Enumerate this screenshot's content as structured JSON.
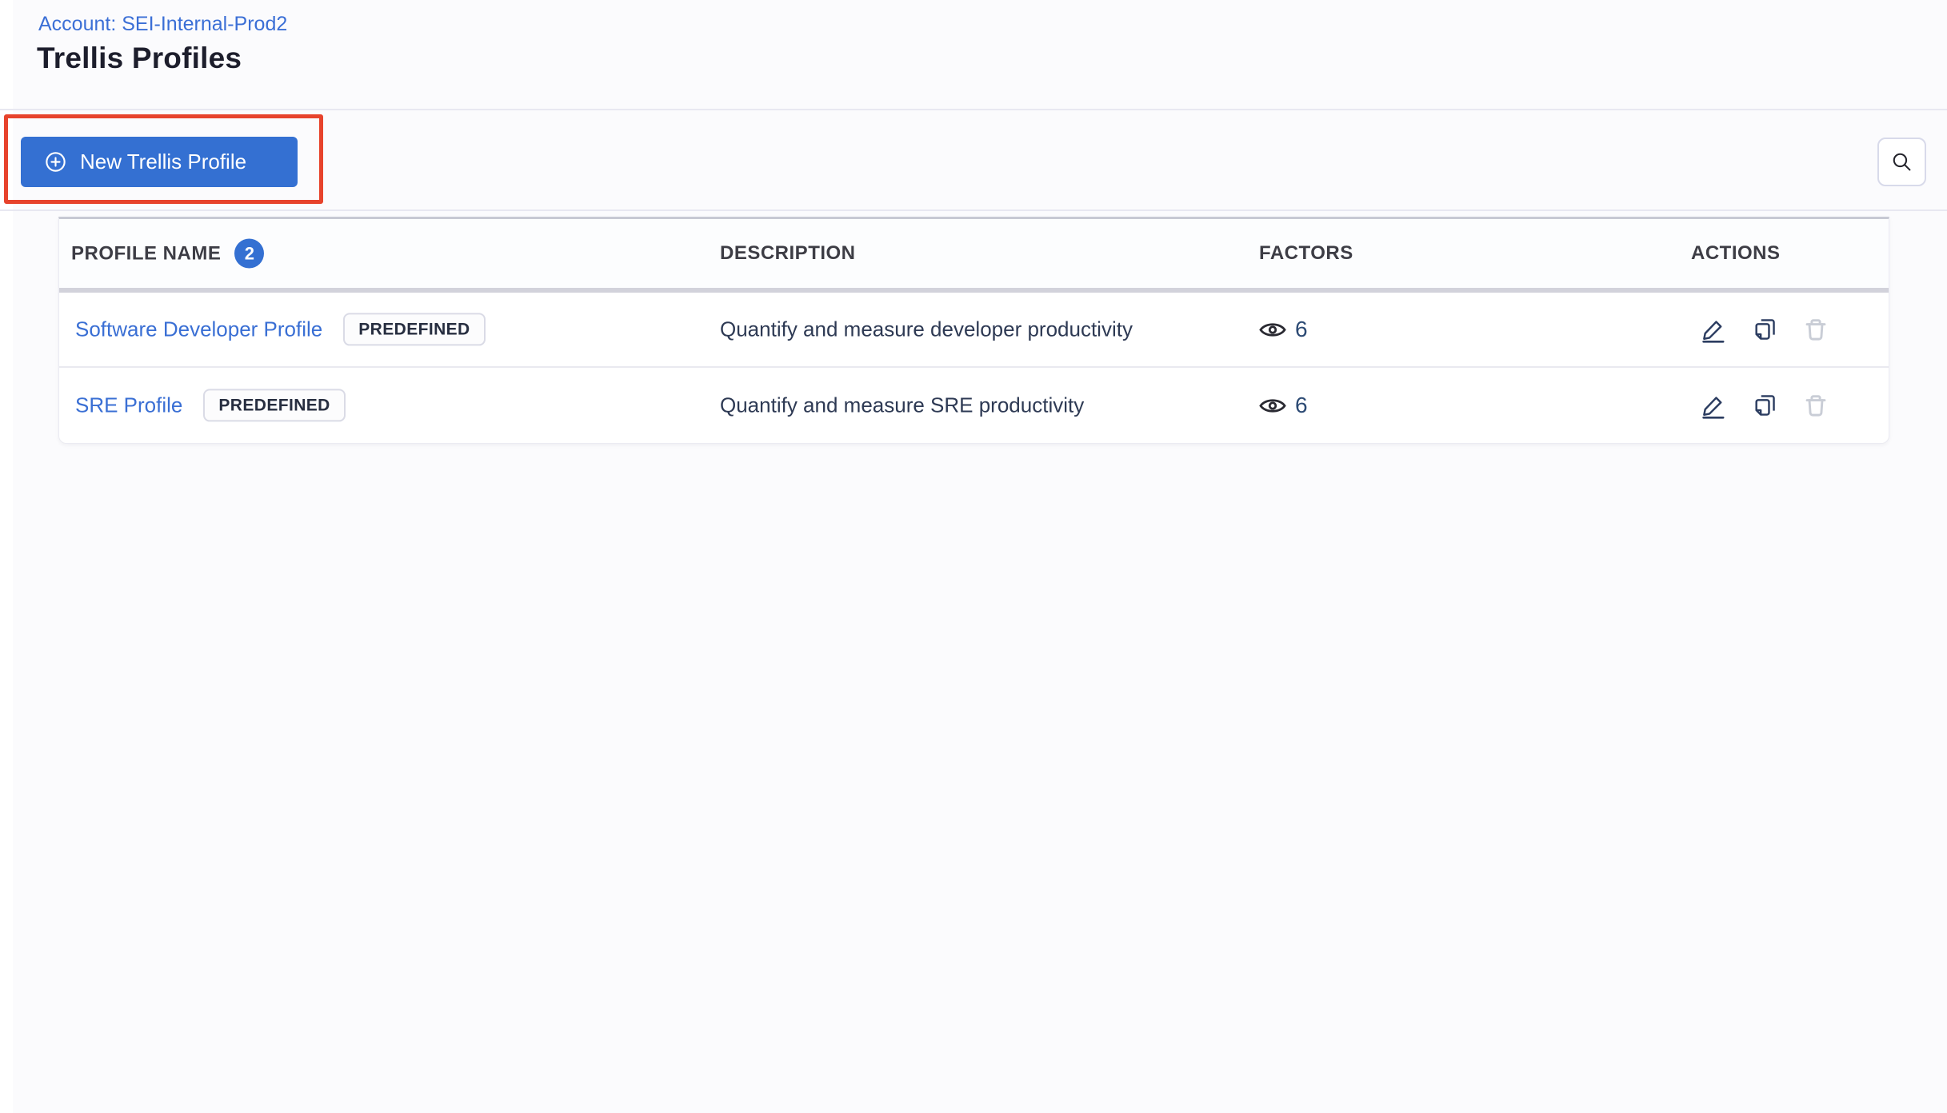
{
  "header": {
    "account_link": "Account: SEI-Internal-Prod2",
    "page_title": "Trellis Profiles"
  },
  "toolbar": {
    "new_profile_button_label": "New Trellis Profile"
  },
  "table": {
    "columns": {
      "profile_name": "PROFILE NAME",
      "description": "DESCRIPTION",
      "factors": "FACTORS",
      "actions": "ACTIONS"
    },
    "profile_count": "2",
    "rows": [
      {
        "name": "Software Developer Profile",
        "tag": "PREDEFINED",
        "description": "Quantify and measure developer productivity",
        "factors_count": "6"
      },
      {
        "name": "SRE Profile",
        "tag": "PREDEFINED",
        "description": "Quantify and measure SRE productivity",
        "factors_count": "6"
      }
    ]
  },
  "icons": {
    "plus_circle": "plus-circle-icon",
    "search": "search-icon",
    "eye": "eye-icon",
    "edit": "edit-pencil-icon",
    "copy": "copy-icon",
    "delete": "trash-icon"
  },
  "colors": {
    "accent_blue": "#3470d2",
    "link_blue": "#3a6fd4",
    "navy_text": "#2e3a54",
    "icon_navy": "#2b3c60",
    "annotation_red": "#e7432c",
    "disabled_gray": "#c9cdd6",
    "header_text": "#3d3d45",
    "divider": "#e8e8f1"
  }
}
